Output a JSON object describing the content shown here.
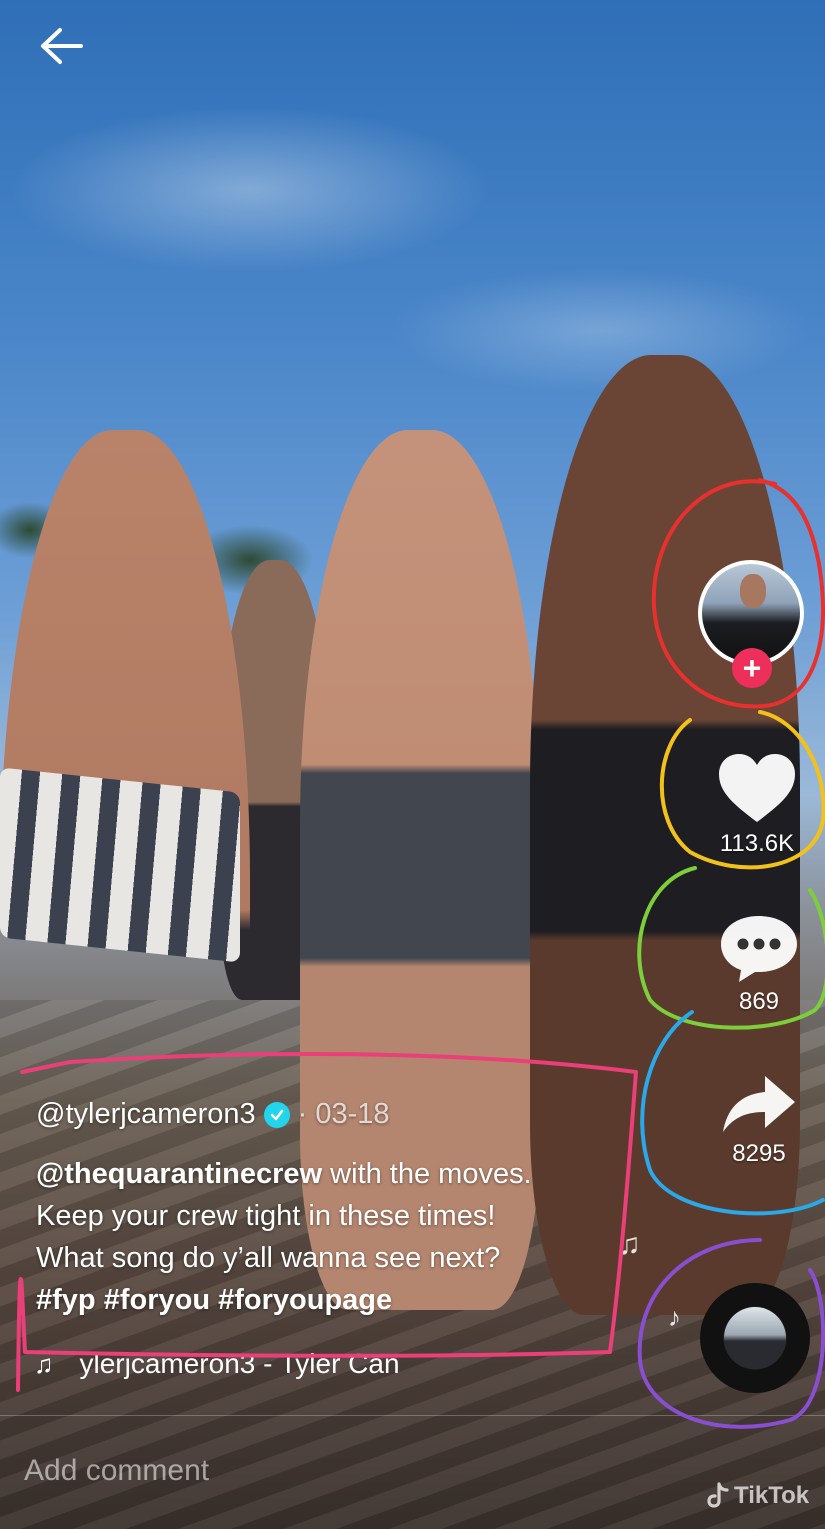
{
  "nav": {
    "back_icon": "arrow-left-icon"
  },
  "creator": {
    "avatar_icon": "avatar",
    "follow_symbol": "+"
  },
  "actions": {
    "like_count": "113.6K",
    "comment_count": "869",
    "share_count": "8295"
  },
  "post": {
    "username": "@tylerjcameron3",
    "date": "· 03-18",
    "mention": "@thequarantinecrew",
    "line1_rest": " with the moves.",
    "line2": "Keep your crew tight in these times!",
    "line3": "What song do y’all wanna see next?",
    "hashtags": [
      "#fyp",
      "#foryou",
      "#foryoupage"
    ]
  },
  "music": {
    "notes_symbol": "♫",
    "text": "ylerjcameron3 - Tyler Can"
  },
  "comment": {
    "placeholder": "Add comment"
  },
  "watermark": {
    "text": "TikTok"
  },
  "colors": {
    "follow_red": "#ee2e5b",
    "verified_cyan": "#20d5ec",
    "annot_red": "#e8302f",
    "annot_yellow": "#f2c21b",
    "annot_green": "#7ccf3a",
    "annot_blue": "#2aa8e8",
    "annot_purple": "#8a4fd1",
    "annot_pink": "#ea3f78"
  }
}
